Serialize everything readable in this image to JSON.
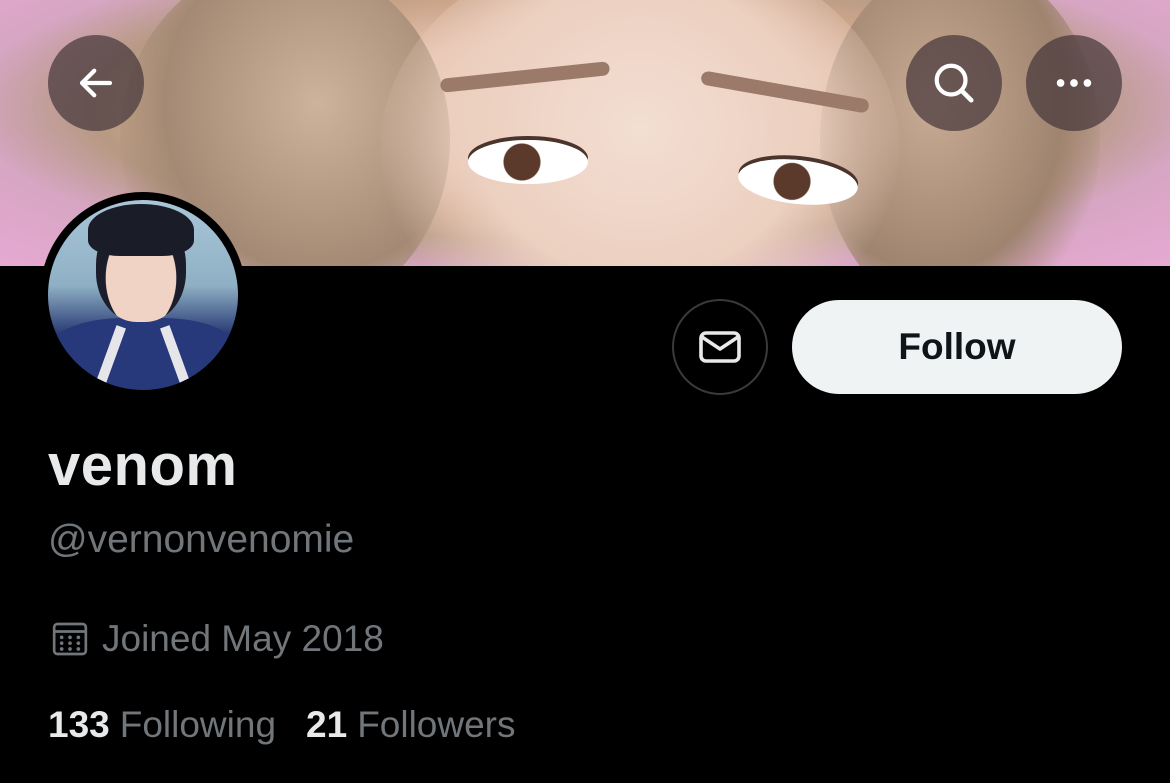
{
  "header": {
    "back_icon": "arrow-left-icon",
    "search_icon": "search-icon",
    "more_icon": "more-horizontal-icon"
  },
  "profile": {
    "display_name": "venom",
    "handle": "@vernonvenomie",
    "joined": "Joined May 2018",
    "joined_icon": "calendar-icon"
  },
  "actions": {
    "message_icon": "envelope-icon",
    "follow_label": "Follow"
  },
  "stats": {
    "following_count": "133",
    "following_label": "Following",
    "followers_count": "21",
    "followers_label": "Followers"
  },
  "colors": {
    "background": "#000000",
    "primary_text": "#e7e9ea",
    "secondary_text": "#71767b",
    "follow_button_bg": "#eff3f4",
    "follow_button_text": "#0f1419"
  }
}
